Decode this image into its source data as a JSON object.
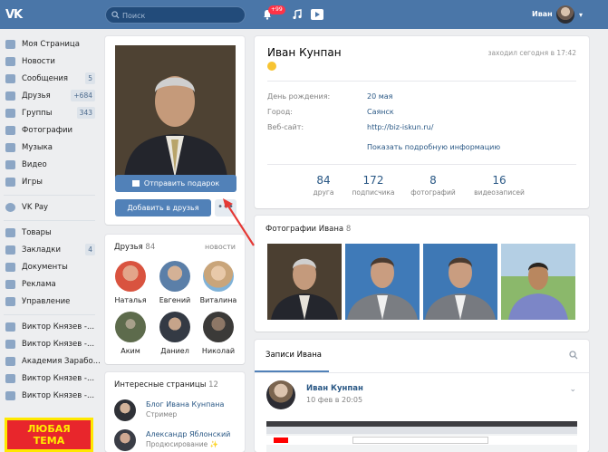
{
  "topbar": {
    "logo": "VK",
    "search_placeholder": "Поиск",
    "notifications_badge": "+99",
    "user_name": "Иван"
  },
  "menu": {
    "main": [
      {
        "label": "Моя Страница",
        "count": ""
      },
      {
        "label": "Новости",
        "count": ""
      },
      {
        "label": "Сообщения",
        "count": "5"
      },
      {
        "label": "Друзья",
        "count": "+684"
      },
      {
        "label": "Группы",
        "count": "343"
      },
      {
        "label": "Фотографии",
        "count": ""
      },
      {
        "label": "Музыка",
        "count": ""
      },
      {
        "label": "Видео",
        "count": ""
      },
      {
        "label": "Игры",
        "count": ""
      }
    ],
    "pay": {
      "label": "VK Pay"
    },
    "more": [
      {
        "label": "Товары",
        "count": ""
      },
      {
        "label": "Закладки",
        "count": "4"
      },
      {
        "label": "Документы",
        "count": ""
      },
      {
        "label": "Реклама",
        "count": ""
      },
      {
        "label": "Управление",
        "count": ""
      }
    ],
    "groups": [
      {
        "label": "Виктор Князев -..."
      },
      {
        "label": "Виктор Князев -..."
      },
      {
        "label": "Академия Зарабо..."
      },
      {
        "label": "Виктор Князев -..."
      },
      {
        "label": "Виктор Князев -..."
      }
    ],
    "ad_text_line1": "ЛЮБАЯ",
    "ad_text_line2": "ТЕМА"
  },
  "profile": {
    "gift_button": "Отправить подарок",
    "add_friend_button": "Добавить в друзья",
    "more_button": "•••",
    "name": "Иван Кунпан",
    "last_seen": "заходил сегодня в 17:42",
    "info": [
      {
        "key": "День рождения:",
        "value": "20 мая"
      },
      {
        "key": "Город:",
        "value": "Саянск"
      },
      {
        "key": "Веб-сайт:",
        "value": "http://biz-iskun.ru/"
      }
    ],
    "show_more": "Показать подробную информацию",
    "stats": [
      {
        "n": "84",
        "label": "друга"
      },
      {
        "n": "172",
        "label": "подписчика"
      },
      {
        "n": "8",
        "label": "фотографий"
      },
      {
        "n": "16",
        "label": "видеозаписей"
      }
    ]
  },
  "friends": {
    "title": "Друзья",
    "count": "84",
    "link": "новости",
    "items": [
      {
        "name": "Наталья",
        "color": "#d9533f"
      },
      {
        "name": "Евгений",
        "color": "#5b7fa8"
      },
      {
        "name": "Виталина",
        "color": "#c9a57a"
      },
      {
        "name": "Аким",
        "color": "#5d6b4c"
      },
      {
        "name": "Даниел",
        "color": "#343a44"
      },
      {
        "name": "Николай",
        "color": "#3b3a38"
      }
    ]
  },
  "interests": {
    "title": "Интересные страницы",
    "count": "12",
    "items": [
      {
        "title": "Блог Ивана Кунпана",
        "subtitle": "Стример"
      },
      {
        "title": "Александр Яблонский",
        "subtitle": "Продюсирование ✨"
      }
    ]
  },
  "photos": {
    "title": "Фотографии Ивана",
    "count": "8"
  },
  "wall": {
    "tab": "Записи Ивана",
    "post_author": "Иван Кунпан",
    "post_date": "10 фев в 20:05"
  }
}
